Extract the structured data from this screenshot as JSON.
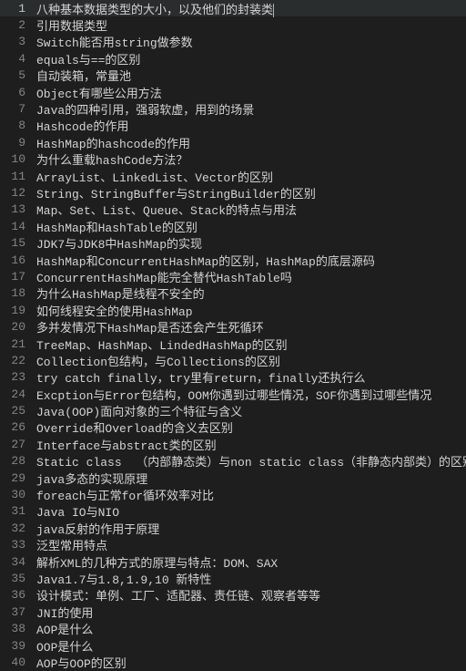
{
  "lines": [
    {
      "n": 1,
      "text": "八种基本数据类型的大小，以及他们的封装类",
      "current": true
    },
    {
      "n": 2,
      "text": "引用数据类型"
    },
    {
      "n": 3,
      "text": "Switch能否用string做参数"
    },
    {
      "n": 4,
      "text": "equals与==的区别"
    },
    {
      "n": 5,
      "text": "自动装箱，常量池"
    },
    {
      "n": 6,
      "text": "Object有哪些公用方法"
    },
    {
      "n": 7,
      "text": "Java的四种引用，强弱软虚，用到的场景"
    },
    {
      "n": 8,
      "text": "Hashcode的作用"
    },
    {
      "n": 9,
      "text": "HashMap的hashcode的作用"
    },
    {
      "n": 10,
      "text": "为什么重载hashCode方法？"
    },
    {
      "n": 11,
      "text": "ArrayList、LinkedList、Vector的区别"
    },
    {
      "n": 12,
      "text": "String、StringBuffer与StringBuilder的区别"
    },
    {
      "n": 13,
      "text": "Map、Set、List、Queue、Stack的特点与用法"
    },
    {
      "n": 14,
      "text": "HashMap和HashTable的区别"
    },
    {
      "n": 15,
      "text": "JDK7与JDK8中HashMap的实现"
    },
    {
      "n": 16,
      "text": "HashMap和ConcurrentHashMap的区别，HashMap的底层源码"
    },
    {
      "n": 17,
      "text": "ConcurrentHashMap能完全替代HashTable吗"
    },
    {
      "n": 18,
      "text": "为什么HashMap是线程不安全的"
    },
    {
      "n": 19,
      "text": "如何线程安全的使用HashMap"
    },
    {
      "n": 20,
      "text": "多并发情况下HashMap是否还会产生死循环"
    },
    {
      "n": 21,
      "text": "TreeMap、HashMap、LindedHashMap的区别"
    },
    {
      "n": 22,
      "text": "Collection包结构，与Collections的区别"
    },
    {
      "n": 23,
      "text": "try catch finally，try里有return，finally还执行么"
    },
    {
      "n": 24,
      "text": "Excption与Error包结构，OOM你遇到过哪些情况，SOF你遇到过哪些情况"
    },
    {
      "n": 25,
      "text": "Java(OOP)面向对象的三个特征与含义"
    },
    {
      "n": 26,
      "text": "Override和Overload的含义去区别"
    },
    {
      "n": 27,
      "text": "Interface与abstract类的区别"
    },
    {
      "n": 28,
      "text": "Static class  （内部静态类）与non static class（非静态内部类）的区别"
    },
    {
      "n": 29,
      "text": "java多态的实现原理"
    },
    {
      "n": 30,
      "text": "foreach与正常for循环效率对比"
    },
    {
      "n": 31,
      "text": "Java IO与NIO"
    },
    {
      "n": 32,
      "text": "java反射的作用于原理"
    },
    {
      "n": 33,
      "text": "泛型常用特点"
    },
    {
      "n": 34,
      "text": "解析XML的几种方式的原理与特点：DOM、SAX"
    },
    {
      "n": 35,
      "text": "Java1.7与1.8,1.9,10 新特性"
    },
    {
      "n": 36,
      "text": "设计模式：单例、工厂、适配器、责任链、观察者等等"
    },
    {
      "n": 37,
      "text": "JNI的使用"
    },
    {
      "n": 38,
      "text": "AOP是什么"
    },
    {
      "n": 39,
      "text": "OOP是什么"
    },
    {
      "n": 40,
      "text": "AOP与OOP的区别"
    }
  ]
}
